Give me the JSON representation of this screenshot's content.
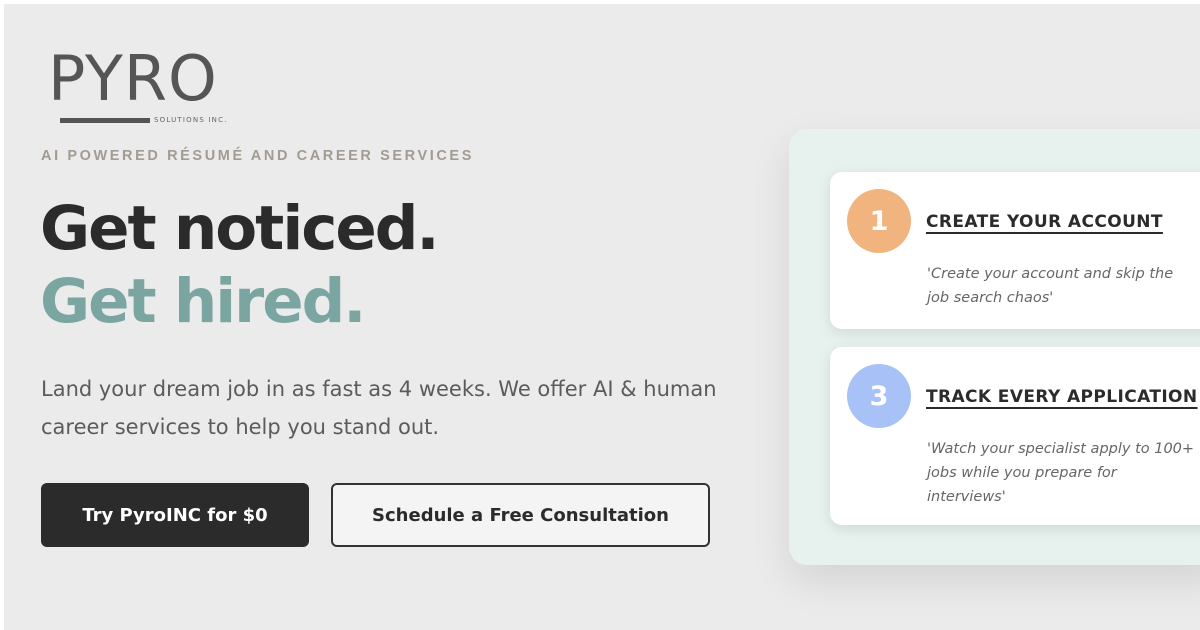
{
  "brand": {
    "logo_word": "PYRO",
    "logo_sub": "SOLUTIONS INC."
  },
  "hero": {
    "eyebrow": "AI POWERED RÉSUMÉ AND CAREER SERVICES",
    "headline_line1": "Get noticed.",
    "headline_line2": "Get hired.",
    "description": "Land your dream job in as fast as 4 weeks. We offer AI & human career services to help you stand out.",
    "primary_button": "Try PyroINC for $0",
    "secondary_button": "Schedule a Free Consultation"
  },
  "steps": [
    {
      "number": "1",
      "title": "CREATE YOUR ACCOUNT",
      "text": "'Create your account and skip the job search chaos'",
      "color": "#f2b47e"
    },
    {
      "number": "3",
      "title": "TRACK EVERY APPLICATION",
      "text": "'Watch your specialist apply to 100+ jobs while you prepare for interviews'",
      "color": "#a8c2f7"
    }
  ],
  "colors": {
    "background": "#ebebeb",
    "accent_teal": "#7aa5a0",
    "dark": "#2b2b2b",
    "panel": "#e7f2ef"
  }
}
